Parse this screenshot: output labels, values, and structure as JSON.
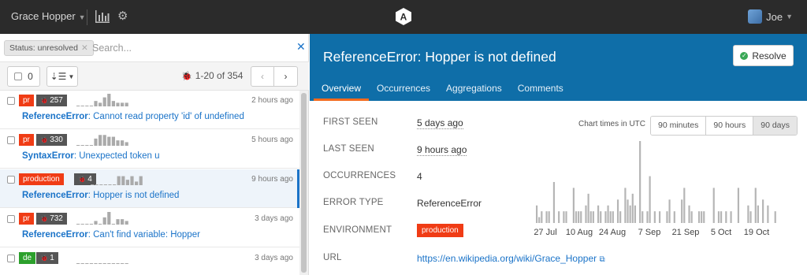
{
  "topbar": {
    "project": "Grace Hopper",
    "user": "Joe",
    "icons": [
      "bar-chart-icon",
      "gear-icon",
      "app-logo-icon",
      "avatar"
    ]
  },
  "search": {
    "status_filter": "Status: unresolved",
    "placeholder": "Search..."
  },
  "toolbar": {
    "select_count": "0",
    "pager": "1-20 of 354"
  },
  "errors": [
    {
      "env": "pr",
      "env_color": "#f03c15",
      "count": "257",
      "time": "2 hours ago",
      "type": "ReferenceError",
      "message": ": Cannot read property 'id' of undefined",
      "spark": [
        0,
        0,
        0,
        0,
        3,
        2,
        5,
        7,
        3,
        2,
        2,
        2
      ]
    },
    {
      "env": "pr",
      "env_color": "#f03c15",
      "count": "330",
      "time": "5 hours ago",
      "type": "SyntaxError",
      "message": ": Unexpected token u",
      "spark": [
        0,
        0,
        0,
        0,
        4,
        6,
        6,
        5,
        5,
        3,
        3,
        2
      ]
    },
    {
      "env": "production",
      "env_color": "#f03c15",
      "count": "4",
      "time": "9 hours ago",
      "type": "ReferenceError",
      "message": ": Hopper is not defined",
      "spark": [
        0,
        0,
        0,
        0,
        0,
        0,
        5,
        5,
        3,
        5,
        2,
        5
      ]
    },
    {
      "env": "pr",
      "env_color": "#f03c15",
      "count": "732",
      "time": "3 days ago",
      "type": "ReferenceError",
      "message": ": Can't find variable: Hopper",
      "spark": [
        0,
        0,
        0,
        0,
        2,
        0,
        4,
        7,
        0,
        3,
        3,
        2
      ]
    },
    {
      "env": "de",
      "env_color": "#2ca02c",
      "count": "1",
      "time": "3 days ago",
      "type": "",
      "message": "",
      "spark": [
        0,
        0,
        0,
        0,
        0,
        0,
        0,
        0,
        0,
        0,
        0,
        0
      ]
    }
  ],
  "detail": {
    "title": "ReferenceError: Hopper is not defined",
    "resolve_label": "Resolve",
    "tabs": [
      "Overview",
      "Occurrences",
      "Aggregations",
      "Comments"
    ],
    "fields": [
      {
        "label": "FIRST SEEN",
        "value": "5 days ago"
      },
      {
        "label": "LAST SEEN",
        "value": "9 hours ago"
      },
      {
        "label": "OCCURRENCES",
        "value": "4"
      },
      {
        "label": "ERROR TYPE",
        "value": "ReferenceError"
      },
      {
        "label": "ENVIRONMENT",
        "value": "production"
      },
      {
        "label": "URL",
        "value": "https://en.wikipedia.org/wiki/Grace_Hopper"
      }
    ]
  },
  "chart_controls": {
    "utc_label": "Chart times in UTC",
    "ranges": [
      "90 minutes",
      "90 hours",
      "90 days"
    ],
    "active_range": "90 days"
  },
  "chart_data": {
    "type": "bar",
    "title": "",
    "xlabel": "",
    "ylabel": "",
    "tick_labels": [
      "27 Jul",
      "10 Aug",
      "24 Aug",
      "7 Sep",
      "21 Sep",
      "5 Oct",
      "19 Oct"
    ],
    "values": [
      3,
      1,
      2,
      0,
      2,
      2,
      0,
      7,
      0,
      2,
      0,
      2,
      2,
      0,
      0,
      6,
      2,
      2,
      2,
      0,
      3,
      5,
      2,
      2,
      0,
      3,
      2,
      0,
      2,
      3,
      2,
      2,
      0,
      4,
      2,
      0,
      6,
      4,
      3,
      5,
      3,
      0,
      14,
      2,
      0,
      2,
      8,
      0,
      2,
      0,
      2,
      0,
      0,
      2,
      4,
      0,
      2,
      0,
      0,
      4,
      6,
      0,
      3,
      2,
      0,
      0,
      2,
      2,
      2,
      0,
      0,
      0,
      6,
      0,
      2,
      2,
      0,
      2,
      0,
      2,
      0,
      0,
      6,
      0,
      0,
      0,
      3,
      2,
      0,
      6,
      3,
      0,
      4,
      0,
      3,
      0,
      0,
      2,
      0,
      0
    ]
  }
}
